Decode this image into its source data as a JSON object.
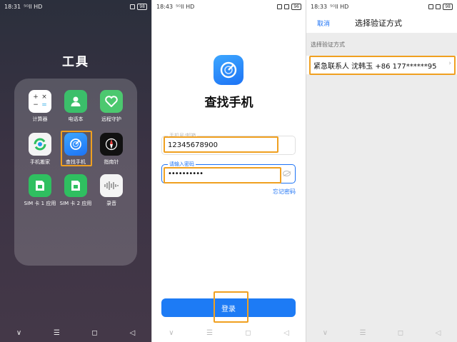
{
  "screen1": {
    "time": "18:31",
    "signal": "⁵ᴳll HD",
    "battery": "98",
    "folder_title": "工具",
    "apps": [
      {
        "label": "计算器",
        "icon": "calculator-icon",
        "color": "#ffffff"
      },
      {
        "label": "电话本",
        "icon": "contacts-icon",
        "color": "#3bbf6a"
      },
      {
        "label": "远程守护",
        "icon": "heart-shield-icon",
        "color": "#4cc86f"
      },
      {
        "label": "手机搬家",
        "icon": "phone-clone-icon",
        "color": "#f4f4f4"
      },
      {
        "label": "查找手机",
        "icon": "find-phone-icon",
        "color": "#1d73f5"
      },
      {
        "label": "指南针",
        "icon": "compass-icon",
        "color": "#111111"
      },
      {
        "label": "SIM 卡 1 应用",
        "icon": "sim1-icon",
        "color": "#2fbf60"
      },
      {
        "label": "SIM 卡 2 应用",
        "icon": "sim2-icon",
        "color": "#2fbf60"
      },
      {
        "label": "录音",
        "icon": "recorder-icon",
        "color": "#f4f4f4"
      }
    ],
    "nav": [
      "∨",
      "☰",
      "◻",
      "◁"
    ]
  },
  "screen2": {
    "time": "18:43",
    "signal": "⁵ᴳll HD",
    "battery": "96",
    "app_title": "查找手机",
    "account_label": "手机号/邮箱",
    "account_value": "12345678900",
    "password_label": "请输入密码",
    "password_value": "••••••••••",
    "forgot_label": "忘记密码",
    "login_label": "登录",
    "nav": [
      "∨",
      "☰",
      "◻",
      "◁"
    ]
  },
  "screen3": {
    "time": "18:33",
    "signal": "⁵ᴳll HD",
    "battery": "98",
    "cancel_label": "取消",
    "title": "选择验证方式",
    "section_label": "选择验证方式",
    "option_text": "紧急联系人 沈韩玉 +86 177******95",
    "chevron": "›",
    "nav": [
      "∨",
      "☰",
      "◻",
      "◁"
    ]
  },
  "colors": {
    "accent": "#1d73f5",
    "highlight": "#f0a020"
  }
}
